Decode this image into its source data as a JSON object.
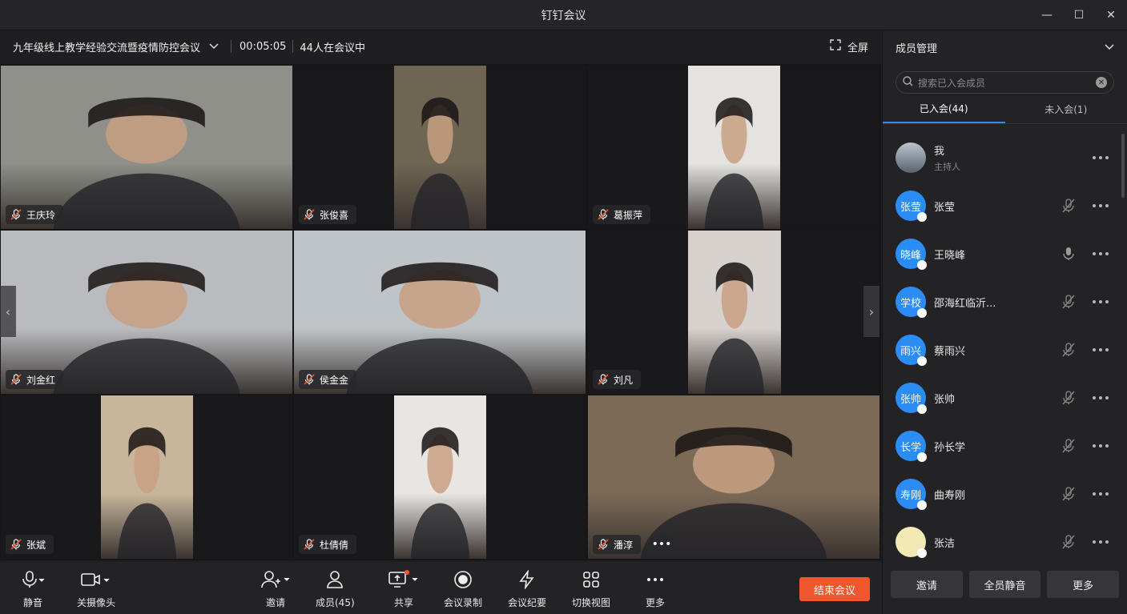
{
  "app": {
    "title": "钉钉会议",
    "window_controls": {
      "minimize": "—",
      "maximize": "☐",
      "close": "✕"
    }
  },
  "meeting": {
    "title": "九年级线上教学经验交流暨疫情防控会议",
    "elapsed": "00:05:05",
    "participants_text": "44人在会议中",
    "fullscreen_label": "全屏"
  },
  "tiles": [
    {
      "name": "王庆玲",
      "bg": "#8e9089",
      "mic": "muted"
    },
    {
      "name": "张俊喜",
      "bg": "#6f6553",
      "mic": "muted"
    },
    {
      "name": "葛振萍",
      "bg": "#e4e3df",
      "mic": "muted"
    },
    {
      "name": "刘金红",
      "bg": "#b9bbbe",
      "mic": "muted"
    },
    {
      "name": "侯金金",
      "bg": "#bfc4c8",
      "mic": "muted"
    },
    {
      "name": "刘凡",
      "bg": "#d7d2ce",
      "mic": "muted"
    },
    {
      "name": "张斌",
      "bg": "#c7b69c",
      "mic": "muted"
    },
    {
      "name": "杜倩倩",
      "bg": "#e8e5e2",
      "mic": "muted"
    },
    {
      "name": "潘淳",
      "bg": "#7c6a57",
      "mic": "muted",
      "more": "•••"
    }
  ],
  "toolbar": {
    "mute": "静音",
    "camera_off": "关摄像头",
    "invite": "邀请",
    "members": "成员(45)",
    "share": "共享",
    "record": "会议录制",
    "minutes": "会议纪要",
    "switch_view": "切换视图",
    "more": "更多",
    "end_meeting": "结束会议"
  },
  "panel": {
    "title": "成员管理",
    "search_placeholder": "搜索已入会成员",
    "tab_joined": "已入会(44)",
    "tab_not_joined": "未入会(1)",
    "members": [
      {
        "avatar_text": "",
        "name": "我",
        "sub": "主持人",
        "mic": "none"
      },
      {
        "avatar_text": "张莹",
        "name": "张莹",
        "mic": "muted"
      },
      {
        "avatar_text": "晓峰",
        "name": "王晓峰",
        "mic": "on"
      },
      {
        "avatar_text": "学校",
        "name": "邵海红临沂...",
        "mic": "muted"
      },
      {
        "avatar_text": "雨兴",
        "name": "蔡雨兴",
        "mic": "muted"
      },
      {
        "avatar_text": "张帅",
        "name": "张帅",
        "mic": "muted"
      },
      {
        "avatar_text": "长学",
        "name": "孙长学",
        "mic": "muted"
      },
      {
        "avatar_text": "寿刚",
        "name": "曲寿刚",
        "mic": "muted"
      },
      {
        "avatar_text": "",
        "name": "张洁",
        "mic": "muted"
      }
    ],
    "footer": {
      "invite": "邀请",
      "mute_all": "全员静音",
      "more": "更多"
    }
  },
  "colors": {
    "accent": "#2f8af5",
    "end_button": "#f0572f",
    "avatar": "#2a8cf4"
  }
}
